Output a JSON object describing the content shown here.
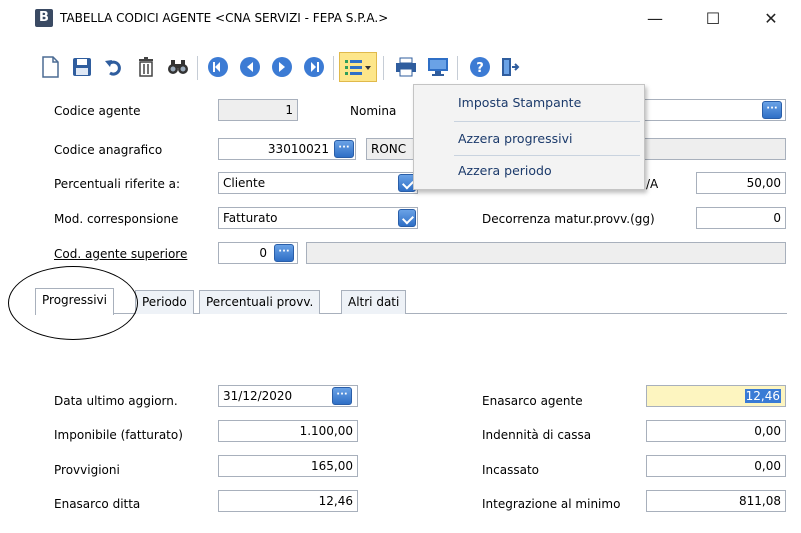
{
  "window": {
    "app_icon": "B",
    "title": "TABELLA CODICI AGENTE <CNA SERVIZI - FEPA S.P.A.>",
    "minimize": "—",
    "maximize": "☐",
    "close": "✕"
  },
  "toolbar": {
    "icons": [
      "new-document-icon",
      "save-icon",
      "undo-icon",
      "delete-icon",
      "find-icon",
      "first-record-icon",
      "prev-record-icon",
      "next-record-icon",
      "last-record-icon",
      "options-menu-icon",
      "print-icon",
      "preview-icon",
      "help-icon",
      "exit-icon"
    ]
  },
  "menu": {
    "items": [
      "Imposta Stampante",
      "Azzera progressivi",
      "Azzera periodo"
    ]
  },
  "form": {
    "codice_agente_label": "Codice agente",
    "codice_agente_value": "1",
    "nominativo_label": "Nomina",
    "codice_anagrafico_label": "Codice anagrafico",
    "codice_anagrafico_value": "33010021",
    "codice_anagrafico_name": "RONC",
    "percentuali_label": "Percentuali riferite a:",
    "percentuali_value": "Cliente",
    "iva_label": "/A",
    "iva_value": "50,00",
    "mod_corresp_label": "Mod. corresponsione",
    "mod_corresp_value": "Fatturato",
    "decorrenza_label": "Decorrenza matur.provv.(gg)",
    "decorrenza_value": "0",
    "cod_sup_label": "Cod. agente superiore",
    "cod_sup_value": "0",
    "ellipsis": "···"
  },
  "tabs": [
    "Progressivi",
    "Periodo",
    "Percentuali provv.",
    "Altri dati"
  ],
  "progressivi": {
    "data_label": "Data ultimo aggiorn.",
    "data_value": "31/12/2020",
    "imponibile_label": "Imponibile (fatturato)",
    "imponibile_value": "1.100,00",
    "provvigioni_label": "Provvigioni",
    "provvigioni_value": "165,00",
    "enasarco_ditta_label": "Enasarco ditta",
    "enasarco_ditta_value": "12,46",
    "enasarco_agente_label": "Enasarco agente",
    "enasarco_agente_value": "12,46",
    "indennita_label": "Indennità di cassa",
    "indennita_value": "0,00",
    "incassato_label": "Incassato",
    "incassato_value": "0,00",
    "integrazione_label": "Integrazione al minimo",
    "integrazione_value": "811,08"
  }
}
